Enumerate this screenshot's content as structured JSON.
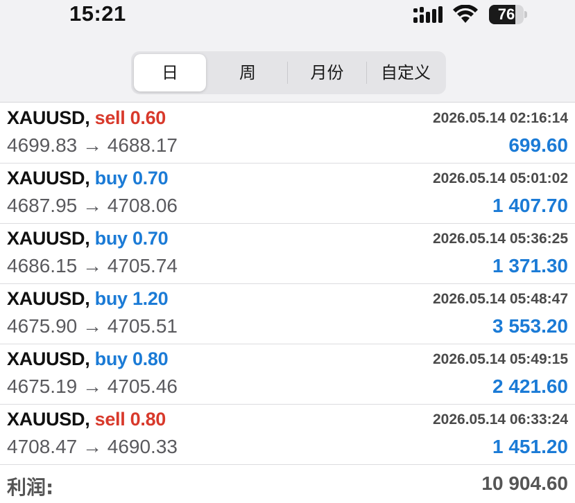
{
  "status_bar": {
    "time": "15:21",
    "battery_level": "76",
    "battery_fraction": 0.76,
    "icons": [
      "cellular-signal-icon",
      "wifi-icon",
      "battery-icon"
    ]
  },
  "period_tabs": {
    "selected": "日",
    "items": [
      {
        "label": "日"
      },
      {
        "label": "周"
      },
      {
        "label": "月份"
      },
      {
        "label": "自定义"
      }
    ]
  },
  "colors": {
    "sell": "#d8392b",
    "buy": "#1b7bd6",
    "profit": "#1b7bd6"
  },
  "trades": [
    {
      "symbol": "XAUUSD,",
      "side": "sell",
      "volume": "0.60",
      "time": "2026.05.14 02:16:14",
      "prices": "4699.83 → 4688.17",
      "profit": "699.60"
    },
    {
      "symbol": "XAUUSD,",
      "side": "buy",
      "volume": "0.70",
      "time": "2026.05.14 05:01:02",
      "prices": "4687.95 → 4708.06",
      "profit": "1 407.70"
    },
    {
      "symbol": "XAUUSD,",
      "side": "buy",
      "volume": "0.70",
      "time": "2026.05.14 05:36:25",
      "prices": "4686.15 → 4705.74",
      "profit": "1 371.30"
    },
    {
      "symbol": "XAUUSD,",
      "side": "buy",
      "volume": "1.20",
      "time": "2026.05.14 05:48:47",
      "prices": "4675.90 → 4705.51",
      "profit": "3 553.20"
    },
    {
      "symbol": "XAUUSD,",
      "side": "buy",
      "volume": "0.80",
      "time": "2026.05.14 05:49:15",
      "prices": "4675.19 → 4705.46",
      "profit": "2 421.60"
    },
    {
      "symbol": "XAUUSD,",
      "side": "sell",
      "volume": "0.80",
      "time": "2026.05.14 06:33:24",
      "prices": "4708.47 → 4690.33",
      "profit": "1 451.20"
    }
  ],
  "summary": {
    "label": "利润:",
    "value": "10 904.60"
  }
}
